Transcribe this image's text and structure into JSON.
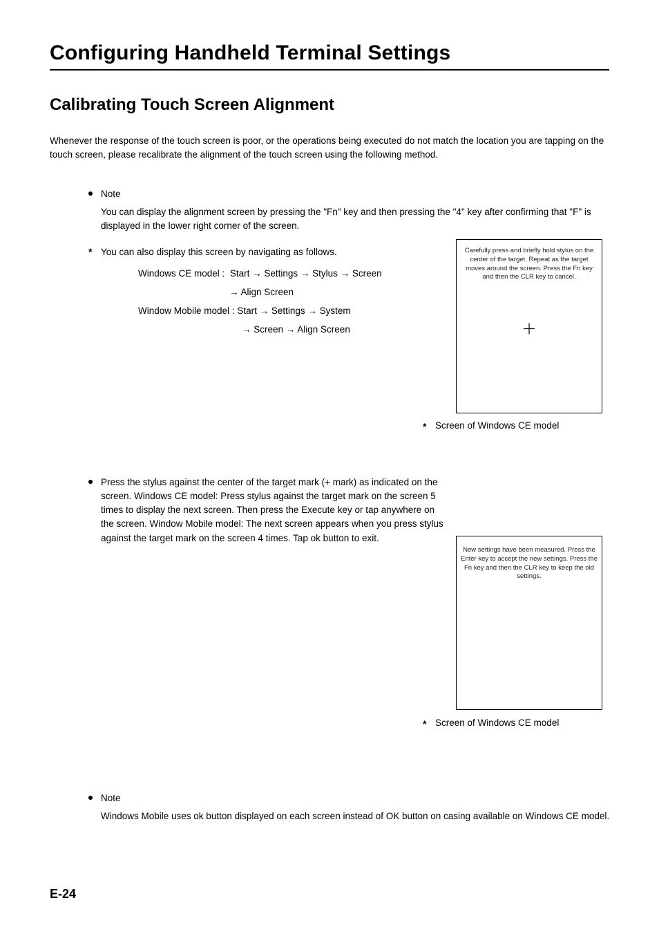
{
  "section_title": "Configuring Handheld Terminal Settings",
  "subsection_title": "Calibrating Touch Screen Alignment",
  "intro": "Whenever the response of the touch screen is poor, or the operations being executed do not match the location you are tapping on the touch screen, please recalibrate the alignment of the touch screen using the following method.",
  "note1_label": "Note",
  "note1_text": "You can display the alignment screen by pressing the \"Fn\" key and then pressing the \"4\" key after confirming that \"F\" is displayed in the lower right corner of the screen.",
  "note1_star": "You can also display this screen by navigating as follows.",
  "method_windows_label": "Windows CE model :",
  "method_windows_path1": "Start → Settings → Stylus → Screen",
  "method_windows_path2": "→ Align Screen",
  "method_mobile_label": "Window Mobile model :",
  "method_mobile_path1": "Start → Settings → System",
  "method_mobile_path2": "→ Screen → Align Screen",
  "screen1_text": "Carefully press and briefly hold stylus on the center of the target. Repeat as the target moves around the screen. Press the Fn key and then the CLR key to cancel.",
  "caption1_star": "*",
  "caption1_text": "Screen of Windows CE model",
  "calib_text": "Press the stylus against the center of the target mark (+ mark) as indicated on the screen. Windows CE model: Press stylus against the target mark on the screen 5 times to display the next screen. Then press the Execute key or tap anywhere on the screen. Window Mobile model: The next screen appears when you press stylus against the target mark on the screen 4 times. Tap ok button to exit.",
  "screen2_text": "New settings have been measured. Press the Enter key to accept the new settings. Press the Fn key and then the CLR key to keep the old settings.",
  "caption2_star": "*",
  "caption2_text": "Screen of Windows CE model",
  "note2_label": "Note",
  "note2_text": "Windows Mobile uses ok button displayed on each screen instead of OK button on casing available on Windows CE model.",
  "page_number": "E-24"
}
